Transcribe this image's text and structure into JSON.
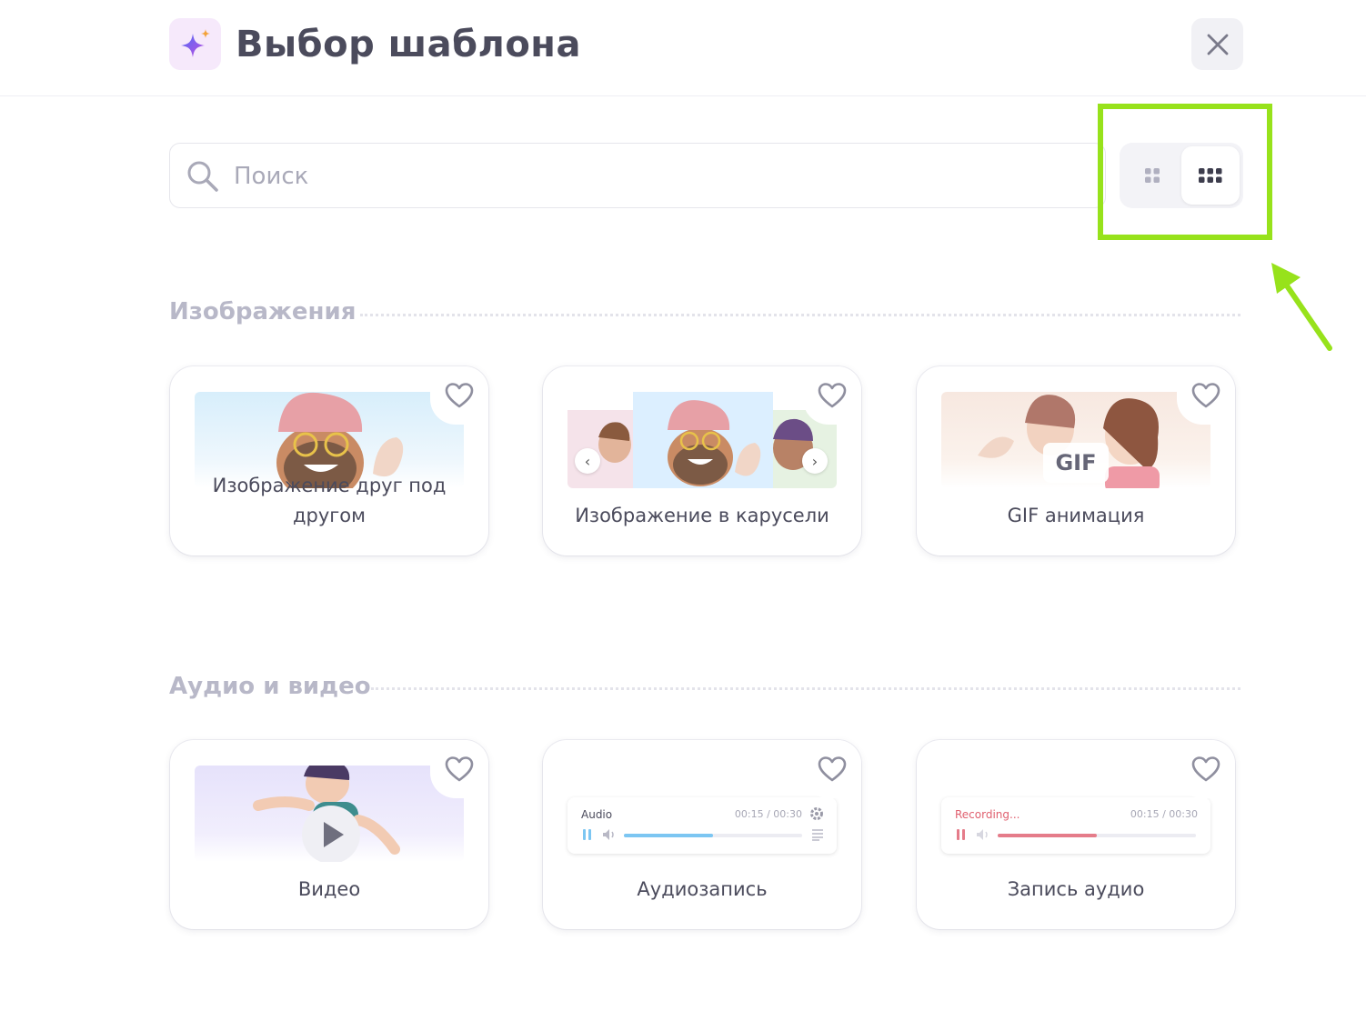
{
  "header": {
    "title": "Выбор шаблона",
    "close_icon": "close-icon",
    "logo_icon": "sparkle-icon"
  },
  "search": {
    "placeholder": "Поиск",
    "value": ""
  },
  "view_toggle": {
    "options": [
      "large-grid",
      "small-grid"
    ],
    "selected": "small-grid"
  },
  "annotation": {
    "color": "#97e21b"
  },
  "sections": [
    {
      "title": "Изображения",
      "cards": [
        {
          "label": "Изображение друг под другом"
        },
        {
          "label": "Изображение в карусели"
        },
        {
          "label": "GIF анимация",
          "badge": "GIF"
        }
      ]
    },
    {
      "title": "Аудио и видео",
      "cards": [
        {
          "label": "Видео"
        },
        {
          "label": "Аудиозапись",
          "player": {
            "title": "Audio",
            "time": "00:15 / 00:30",
            "progress": 0.5,
            "color": "#7cc6f2"
          }
        },
        {
          "label": "Запись аудио",
          "player": {
            "title": "Recording...",
            "time": "00:15 / 00:30",
            "progress": 0.5,
            "color": "#e57c8a"
          }
        }
      ]
    }
  ]
}
